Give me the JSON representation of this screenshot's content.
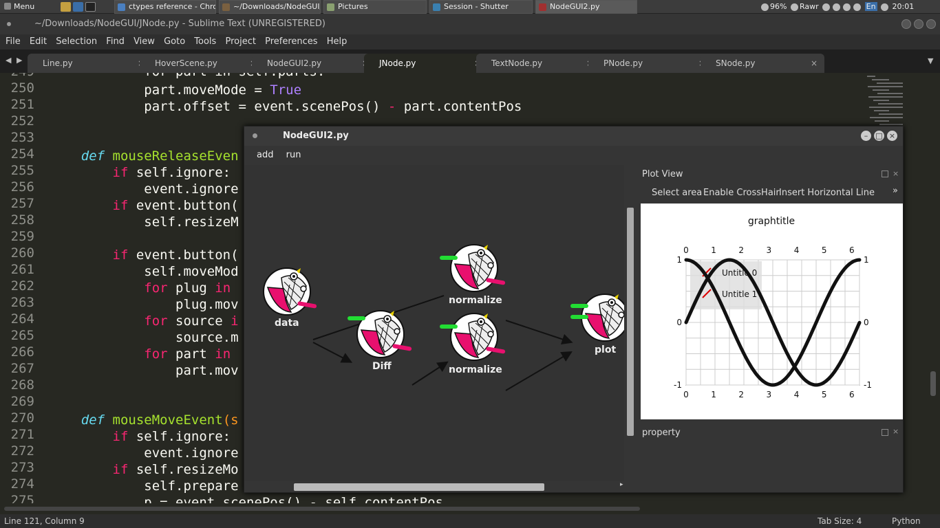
{
  "taskbar": {
    "menu": "Menu",
    "tasks": [
      "ctypes reference - Chro...",
      "~/Downloads/NodeGUI/J...",
      "Pictures",
      "Session - Shutter",
      "NodeGUI2.py"
    ],
    "battery": "96%",
    "user": "Rawr",
    "lang": "En",
    "time": "20:01"
  },
  "sublime": {
    "title": "~/Downloads/NodeGUI/JNode.py - Sublime Text (UNREGISTERED)",
    "menu": [
      "File",
      "Edit",
      "Selection",
      "Find",
      "View",
      "Goto",
      "Tools",
      "Project",
      "Preferences",
      "Help"
    ],
    "tabs": [
      "Line.py",
      "HoverScene.py",
      "NodeGUI2.py",
      "JNode.py",
      "TextNode.py",
      "PNode.py",
      "SNode.py"
    ],
    "lines": [
      "249",
      "250",
      "251",
      "252",
      "253",
      "254",
      "255",
      "256",
      "257",
      "258",
      "259",
      "260",
      "261",
      "262",
      "263",
      "264",
      "265",
      "266",
      "267",
      "268",
      "269",
      "270",
      "271",
      "272",
      "273",
      "274",
      "275"
    ],
    "status_left": "Line 121, Column 9",
    "tab_size": "Tab Size: 4",
    "syntax": "Python"
  },
  "code": {
    "l249": "            for part in self.parts:",
    "l250a": "            part.moveMode = ",
    "l250b": "True",
    "l251a": "            part.offset = event.scenePos() ",
    "l251b": "-",
    "l251c": " part.contentPos",
    "l254a": "    ",
    "l254b": "def",
    "l254c": " mouseReleaseEven",
    "l255a": "        ",
    "l255b": "if",
    "l255c": " self.ignore:",
    "l256": "            event.ignore",
    "l257a": "        ",
    "l257b": "if",
    "l257c": " event.button(",
    "l258": "            self.resizeM",
    "l260a": "        ",
    "l260b": "if",
    "l260c": " event.button(",
    "l261": "            self.moveMod",
    "l262a": "            ",
    "l262b": "for",
    "l262c": " plug ",
    "l262d": "in",
    "l263": "                plug.mov",
    "l264a": "            ",
    "l264b": "for",
    "l264c": " source ",
    "l264d": "i",
    "l265": "                source.m",
    "l266a": "            ",
    "l266b": "for",
    "l266c": " part ",
    "l266d": "in",
    "l267": "                part.mov",
    "l270a": "    ",
    "l270b": "def",
    "l270c": " mouseMoveEvent",
    "l270d": "(s",
    "l271a": "        ",
    "l271b": "if",
    "l271c": " self.ignore:",
    "l272": "            event.ignore",
    "l273a": "        ",
    "l273b": "if",
    "l273c": " self.resizeMo",
    "l274": "            self.prepare",
    "l275": "            p = event.scenePos() - self.contentPos"
  },
  "nodegui": {
    "title": "NodeGUI2.py",
    "menu": [
      "add",
      "run"
    ],
    "nodes": {
      "data": "data",
      "diff": "Diff",
      "norm1": "normalize",
      "norm2": "normalize",
      "plot": "plot"
    },
    "plot_view": {
      "title": "Plot View",
      "toolbar": [
        "Select area",
        "Enable CrossHair",
        "Insert Horizontal Line"
      ],
      "more": "»",
      "property": "property"
    }
  },
  "chart_data": {
    "type": "line",
    "title": "graphtitle",
    "xlabel": "",
    "ylabel": "",
    "xlim": [
      0,
      6.28
    ],
    "ylim": [
      -1,
      1
    ],
    "xticks": [
      "0",
      "1",
      "2",
      "3",
      "4",
      "5",
      "6"
    ],
    "yticks": [
      "1",
      "0",
      "-1"
    ],
    "series": [
      {
        "name": "Untitle 0",
        "function": "sin",
        "x": [
          0,
          0.5,
          1,
          1.5,
          2,
          2.5,
          3,
          3.5,
          4,
          4.5,
          5,
          5.5,
          6,
          6.28
        ],
        "values": [
          0,
          0.48,
          0.84,
          1.0,
          0.91,
          0.6,
          0.14,
          -0.35,
          -0.76,
          -0.98,
          -0.96,
          -0.71,
          -0.28,
          0
        ]
      },
      {
        "name": "Untitle 1",
        "function": "cos",
        "x": [
          0,
          0.5,
          1,
          1.5,
          2,
          2.5,
          3,
          3.5,
          4,
          4.5,
          5,
          5.5,
          6,
          6.28
        ],
        "values": [
          1,
          0.88,
          0.54,
          0.07,
          -0.42,
          -0.8,
          -0.99,
          -0.94,
          -0.65,
          -0.21,
          0.28,
          0.71,
          0.96,
          1
        ]
      }
    ],
    "grid": true,
    "legend": "top-left"
  }
}
